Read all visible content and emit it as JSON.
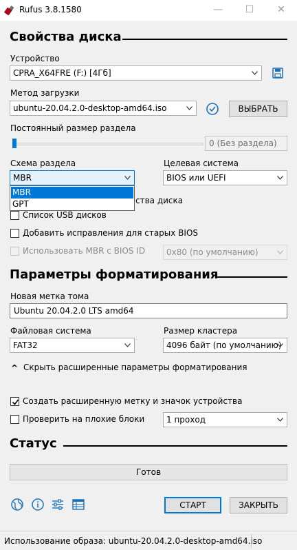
{
  "window": {
    "title": "Rufus 3.8.1580",
    "minimize_glyph": "—",
    "maximize_glyph": "☐",
    "close_glyph": "✕"
  },
  "drive_properties": {
    "heading": "Свойства диска",
    "device_label": "Устройство",
    "device_value": "CPRA_X64FRE (F:) [4Гб]",
    "boot_label": "Метод загрузки",
    "boot_value": "ubuntu-20.04.2.0-desktop-amd64.iso",
    "select_button": "ВЫБРАТЬ",
    "persistent_label": "Постоянный размер раздела",
    "persistent_value": "0 (Без раздела)",
    "persistent_level": 0,
    "partition_label": "Схема раздела",
    "partition_value": "MBR",
    "partition_options": [
      "MBR",
      "GPT"
    ],
    "target_label": "Целевая система",
    "target_value": "BIOS или UEFI",
    "hidden_label_fragment": "ства диска",
    "list_usb_label": "Список USB дисков",
    "list_usb_checked": false,
    "bios_fixes_label": "Добавить исправления для старых BIOS",
    "bios_fixes_checked": false,
    "mbr_bios_label": "Использовать MBR с BIOS ID",
    "mbr_bios_checked": false,
    "bios_id_value": "0x80 (по умолчанию)"
  },
  "format_options": {
    "heading": "Параметры форматирования",
    "volume_label": "Новая метка тома",
    "volume_value": "Ubuntu 20.04.2.0 LTS amd64",
    "fs_label": "Файловая система",
    "fs_value": "FAT32",
    "cluster_label": "Размер кластера",
    "cluster_value": "4096 байт (по умолчанию)",
    "advanced_toggle_glyph": "^",
    "advanced_toggle": "Скрыть расширенные параметры форматирования",
    "extended_label": "Создать расширенную метку и значок устройства",
    "extended_checked": true,
    "bad_blocks_label": "Проверить на плохие блоки",
    "bad_blocks_checked": false,
    "passes_value": "1 проход"
  },
  "status": {
    "heading": "Статус",
    "progress_text": "Готов",
    "progress_level": 0
  },
  "actions": {
    "start_button": "СТАРТ",
    "close_button": "ЗАКРЫТЬ"
  },
  "statusbar": {
    "text": "Использование образа: ubuntu-20.04.2.0-desktop-amd64.iso"
  },
  "colors": {
    "accent": "#0078d7",
    "window_bg": "#f0f0f0",
    "icon_blue": "#1a6fb5"
  }
}
